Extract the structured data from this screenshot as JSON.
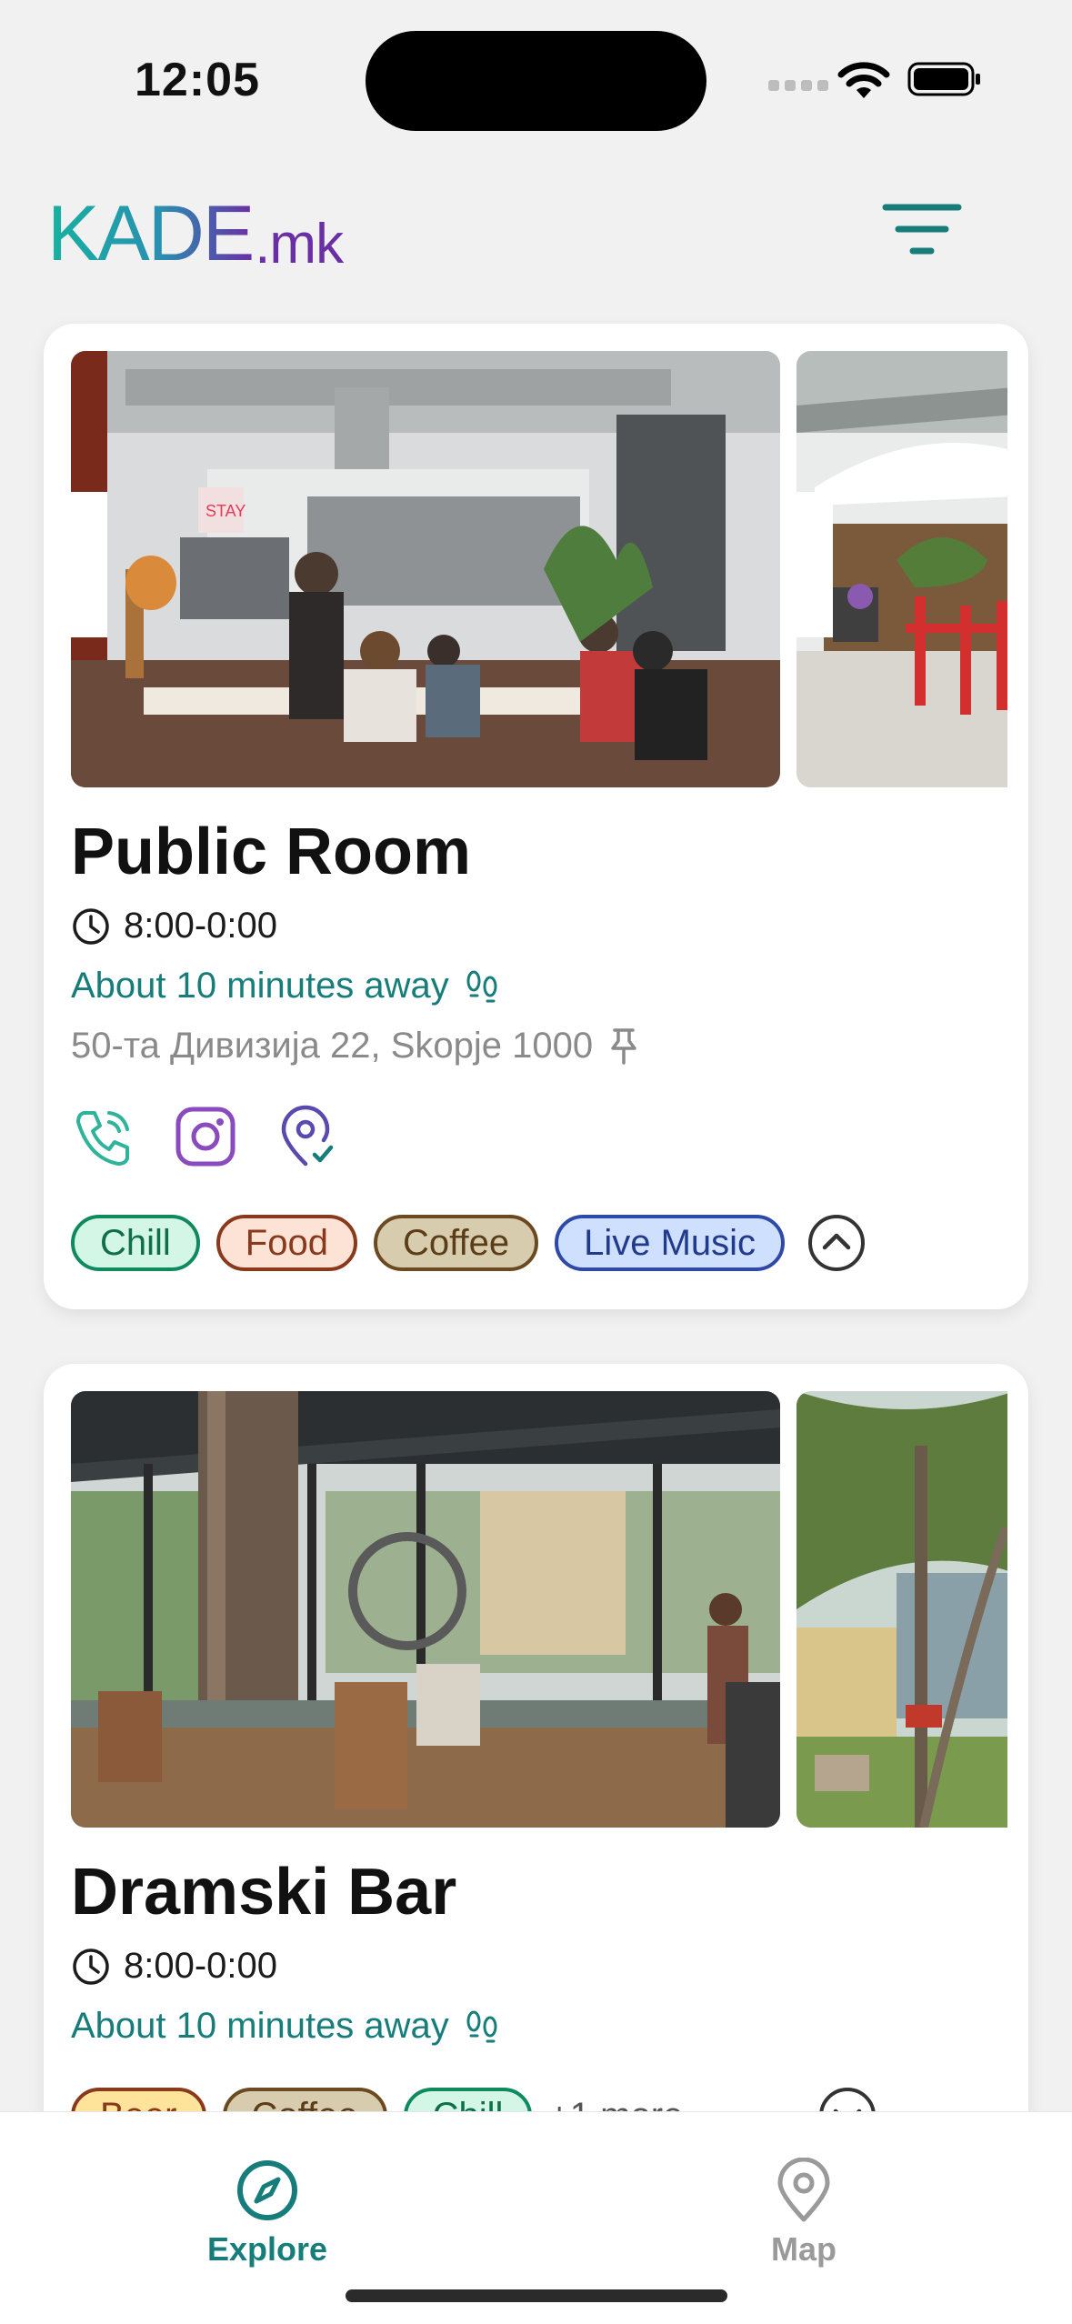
{
  "status_bar": {
    "time": "12:05"
  },
  "header": {
    "logo_main": "KADE",
    "logo_suffix": ".mk",
    "filter_icon": "filter-lines-icon"
  },
  "venues": [
    {
      "name": "Public Room",
      "hours": "8:00-0:00",
      "distance": "About 10 minutes away",
      "address": "50-та Дивизија 22, Skopje 1000",
      "social": [
        "phone-icon",
        "instagram-icon",
        "map-pin-check-icon"
      ],
      "tags": [
        "Chill",
        "Food",
        "Coffee",
        "Live Music"
      ]
    },
    {
      "name": "Dramski Bar",
      "hours": "8:00-0:00",
      "distance": "About 10 minutes away",
      "tags": [
        "Beer",
        "Coffee",
        "Chill"
      ],
      "more": "+1 more"
    }
  ],
  "tab_bar": {
    "tabs": [
      {
        "label": "Explore",
        "icon": "compass-icon",
        "active": true
      },
      {
        "label": "Map",
        "icon": "location-pin-icon",
        "active": false
      }
    ]
  },
  "colors": {
    "accent": "#167d7b",
    "brand_purple": "#6a2fa6",
    "background": "#f1f1f1"
  }
}
